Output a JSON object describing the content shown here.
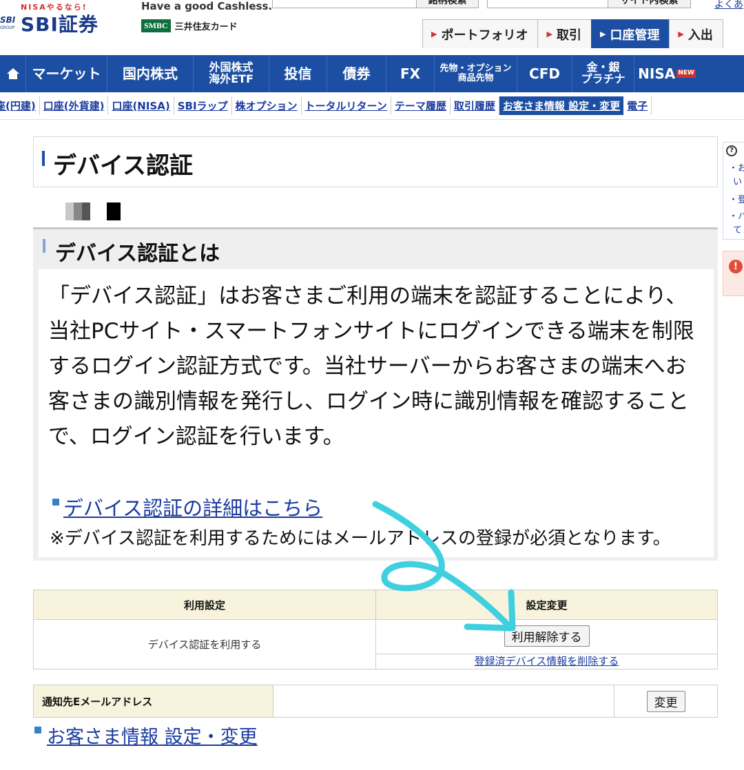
{
  "header": {
    "logo_nisa": "NISAやるなら!",
    "logo_mark": "SBI",
    "logo_text": "SBI証券",
    "logo_group": "GROUP",
    "cashless": "Have a good Cashless.",
    "smbc_badge": "SMBC",
    "smbc_card": "三井住友カード",
    "search_button_1": "銘柄検索",
    "search_button_2": "サイト内検索",
    "top_link": "よくあ",
    "tabs": [
      {
        "label": "ポートフォリオ"
      },
      {
        "label": "取引"
      },
      {
        "label": "口座管理"
      },
      {
        "label": "入出"
      }
    ]
  },
  "gnav": {
    "items": [
      {
        "line1": "マーケット"
      },
      {
        "line1": "国内株式"
      },
      {
        "line1": "外国株式",
        "line2": "海外ETF"
      },
      {
        "line1": "投信"
      },
      {
        "line1": "債券"
      },
      {
        "line1": "FX"
      },
      {
        "line1": "先物・オプション",
        "line2": "商品先物"
      },
      {
        "line1": "CFD"
      },
      {
        "line1": "金・銀",
        "line2": "プラチナ"
      },
      {
        "line1": "NISA",
        "badge": "NEW"
      }
    ]
  },
  "subnav": {
    "items": [
      "座(円建)",
      "口座(外貨建)",
      "口座(NISA)",
      "SBIラップ",
      "株オプション",
      "トータルリターン",
      "テーマ履歴",
      "取引履歴",
      "お客さま情報 設定・変更",
      "電子"
    ]
  },
  "page": {
    "title": "デバイス認証",
    "section_title": "デバイス認証とは",
    "description": "「デバイス認証」はお客さまご利用の端末を認証することにより、当社PCサイト・スマートフォンサイトにログインできる端末を制限するログイン認証方式です。当社サーバーからお客さまの端末へお客さまの識別情報を発行し、ログイン時に識別情報を確認することで、ログイン認証を行います。",
    "detail_link": "デバイス認証の詳細はこちら",
    "note": "※デバイス認証を利用するためにはメールアドレスの登録が必須となります。"
  },
  "setting_table": {
    "col_usage": "利用設定",
    "col_change": "設定変更",
    "usage_value": "デバイス認証を利用する",
    "release_button": "利用解除する",
    "delete_link": "登録済デバイス情報を削除する"
  },
  "email_table": {
    "label": "通知先Eメールアドレス",
    "change_button": "変更"
  },
  "footer_link": "お客さま情報 設定・変更",
  "side_panel": {
    "lines": [
      "・お",
      "い",
      "・登",
      "・ハ",
      "て"
    ]
  },
  "colors": {
    "brand_blue": "#1c4fa3",
    "link_blue": "#1a3aa0",
    "table_header_bg": "#f7f3dc",
    "annotation_cyan": "#3fd0e0"
  }
}
